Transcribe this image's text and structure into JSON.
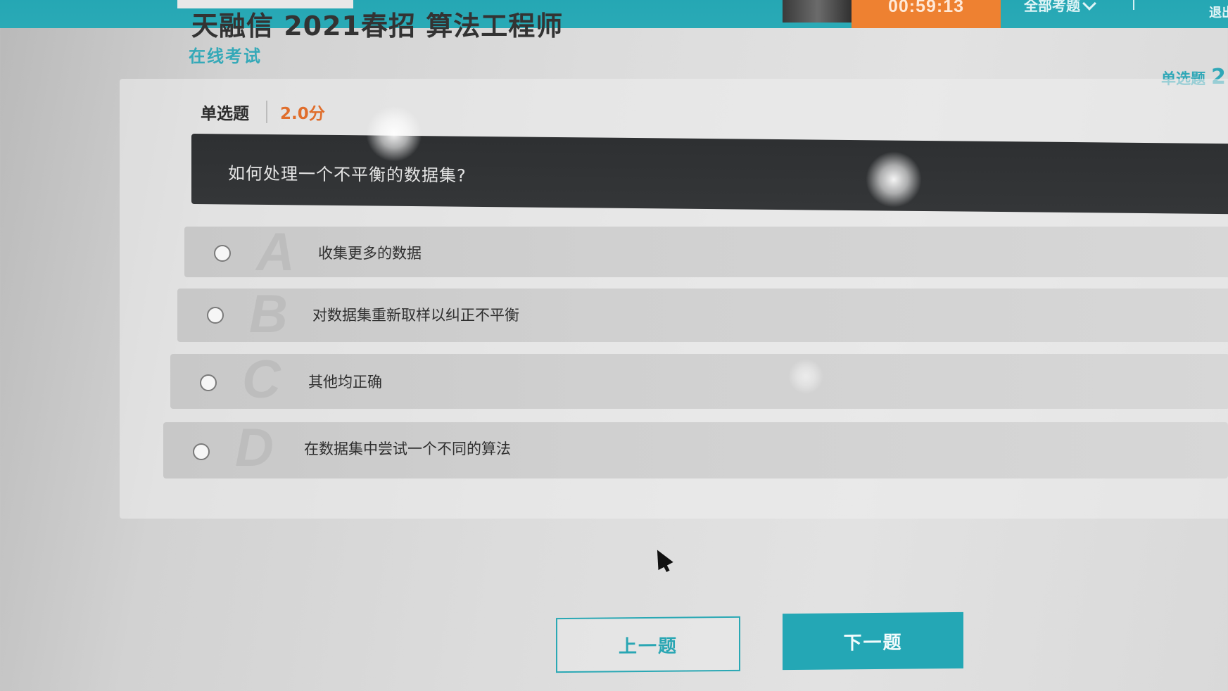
{
  "topbar": {
    "timer": "00:59:13",
    "all_questions": "全部考题",
    "exit": "退出",
    "brand_color": "#2aa8b4",
    "timer_color": "#ee8131"
  },
  "header": {
    "exam_title": "天融信 2021春招 算法工程师",
    "subtitle": "在线考试",
    "type_indicator": "单选题",
    "type_indicator_number": "2"
  },
  "question": {
    "type": "单选题",
    "score": "2.0分",
    "text": "如何处理一个不平衡的数据集?",
    "options": [
      {
        "letter": "A",
        "text": "收集更多的数据"
      },
      {
        "letter": "B",
        "text": "对数据集重新取样以纠正不平衡"
      },
      {
        "letter": "C",
        "text": "其他均正确"
      },
      {
        "letter": "D",
        "text": "在数据集中尝试一个不同的算法"
      }
    ]
  },
  "nav": {
    "prev_label": "上一题",
    "next_label": "下一题"
  }
}
